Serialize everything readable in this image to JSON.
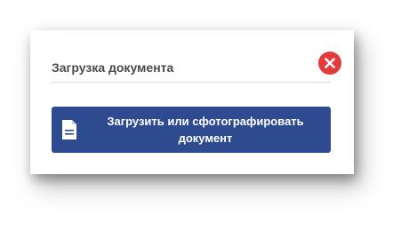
{
  "dialog": {
    "title": "Загрузка документа",
    "close_icon": "close-circle-icon",
    "upload_button": {
      "label": "Загрузить или сфотографировать документ",
      "icon": "document-icon"
    }
  },
  "colors": {
    "close": "#e23b3b",
    "button": "#2f4b8f",
    "title_text": "#4a4a4a"
  }
}
